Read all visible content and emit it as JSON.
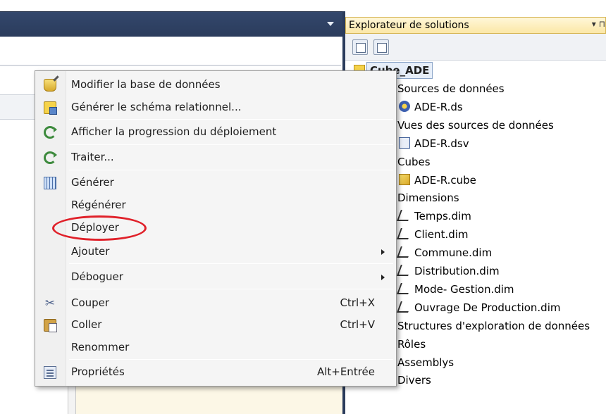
{
  "solution_explorer": {
    "title": "Explorateur de solutions",
    "pin_glyph": "▾ ⊓",
    "root": "Cube_ADE",
    "items": [
      {
        "label": "Sources de données",
        "level": 0,
        "icon": "folder-icon"
      },
      {
        "label": "ADE-R.ds",
        "level": 1,
        "icon": "data-source-icon"
      },
      {
        "label": "Vues des sources de données",
        "level": 0,
        "icon": "folder-icon"
      },
      {
        "label": "ADE-R.dsv",
        "level": 1,
        "icon": "data-source-view-icon"
      },
      {
        "label": "Cubes",
        "level": 0,
        "icon": "folder-icon"
      },
      {
        "label": "ADE-R.cube",
        "level": 1,
        "icon": "cube-icon"
      },
      {
        "label": "Dimensions",
        "level": 0,
        "icon": "folder-icon"
      },
      {
        "label": "Temps.dim",
        "level": 1,
        "icon": "dimension-icon"
      },
      {
        "label": "Client.dim",
        "level": 1,
        "icon": "dimension-icon"
      },
      {
        "label": "Commune.dim",
        "level": 1,
        "icon": "dimension-icon"
      },
      {
        "label": "Distribution.dim",
        "level": 1,
        "icon": "dimension-icon"
      },
      {
        "label": "Mode- Gestion.dim",
        "level": 1,
        "icon": "dimension-icon"
      },
      {
        "label": "Ouvrage De Production.dim",
        "level": 1,
        "icon": "dimension-icon"
      },
      {
        "label": "Structures d'exploration de données",
        "level": 0,
        "icon": "folder-icon"
      },
      {
        "label": "Rôles",
        "level": 0,
        "icon": "folder-icon"
      },
      {
        "label": "Assemblys",
        "level": 0,
        "icon": "folder-icon"
      },
      {
        "label": "Divers",
        "level": 0,
        "icon": "folder-icon"
      }
    ]
  },
  "context_menu": {
    "items": [
      {
        "label": "Modifier la base de données",
        "icon": "edit-database-icon"
      },
      {
        "label": "Générer le schéma relationnel...",
        "icon": "generate-schema-icon"
      },
      {
        "label": "Afficher la progression du déploiement",
        "icon": "deployment-progress-icon"
      },
      {
        "label": "Traiter...",
        "icon": "process-icon"
      },
      {
        "label": "Générer",
        "icon": "build-icon"
      },
      {
        "label": "Régénérer",
        "icon": ""
      },
      {
        "label": "Déployer",
        "icon": ""
      },
      {
        "label": "Ajouter",
        "icon": "",
        "submenu": true
      },
      {
        "label": "Déboguer",
        "icon": "",
        "submenu": true
      },
      {
        "label": "Couper",
        "icon": "cut-icon",
        "shortcut": "Ctrl+X"
      },
      {
        "label": "Coller",
        "icon": "paste-icon",
        "shortcut": "Ctrl+V"
      },
      {
        "label": "Renommer",
        "icon": ""
      },
      {
        "label": "Propriétés",
        "icon": "properties-icon",
        "shortcut": "Alt+Entrée"
      }
    ],
    "highlighted": "Déployer",
    "highlight_color": "#e0212a"
  }
}
